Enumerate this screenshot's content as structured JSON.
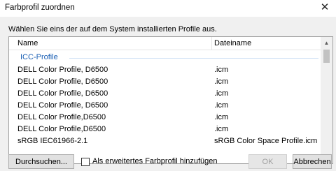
{
  "window": {
    "title": "Farbprofil zuordnen"
  },
  "instruction": "Wählen Sie eins der auf dem System installierten Profile aus.",
  "list": {
    "columns": [
      "Name",
      "Dateiname"
    ],
    "group": "ICC-Profile",
    "rows": [
      {
        "name": "DELL              Color Profile, D6500",
        "file": ".icm"
      },
      {
        "name": "DELL              Color Profile, D6500",
        "file": ".icm"
      },
      {
        "name": "DELL              Color Profile, D6500",
        "file": ".icm"
      },
      {
        "name": "DELL             Color Profile, D6500",
        "file": ".icm"
      },
      {
        "name": "DELL              Color Profile,D6500",
        "file": ".icm"
      },
      {
        "name": "DELL           Color Profile,D6500",
        "file": ".icm"
      },
      {
        "name": "sRGB IEC61966-2.1",
        "file": "sRGB Color Space Profile.icm"
      }
    ]
  },
  "buttons": {
    "browse": "Durchsuchen...",
    "ok": "OK",
    "cancel": "Abbrechen"
  },
  "advanced_checkbox": {
    "label": "Als erweitertes Farbprofil hinzufügen",
    "checked": false
  }
}
